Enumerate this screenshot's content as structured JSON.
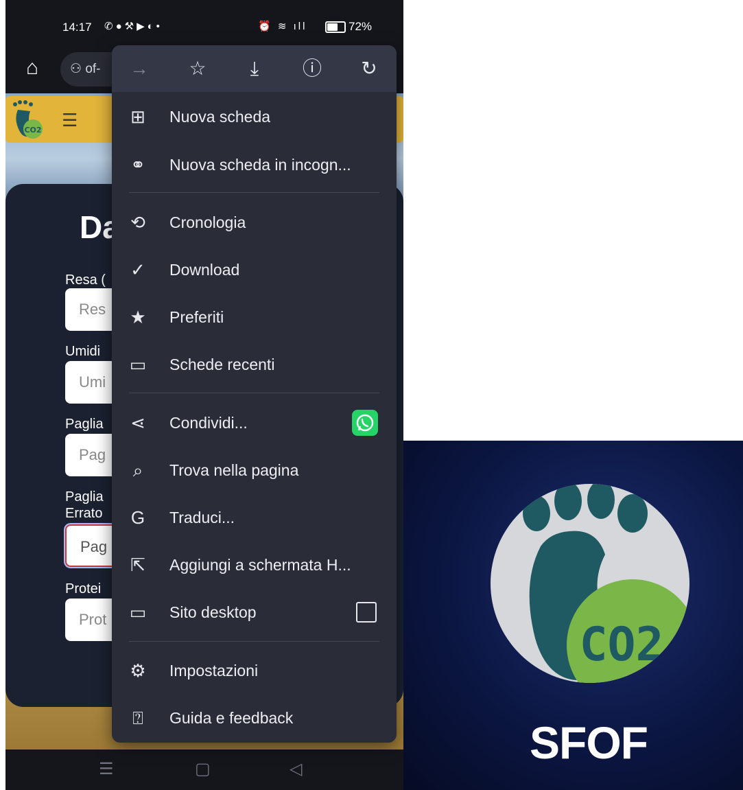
{
  "status_bar": {
    "time": "14:17",
    "notification_icons": [
      "whatsapp-icon",
      "snapchat-icon",
      "tool-icon",
      "youtube-icon",
      "messenger-icon",
      "dot-icon"
    ],
    "system_icons": [
      "alarm-icon",
      "wifi-icon",
      "signal-icon"
    ],
    "battery": "72%"
  },
  "browser": {
    "url_fragment": "of-"
  },
  "webpage": {
    "form_title": "Da",
    "fields": [
      {
        "label": "Resa (",
        "placeholder": "Res"
      },
      {
        "label": "Umidi",
        "placeholder": "Umi"
      },
      {
        "label": "Paglia",
        "placeholder": "Pag"
      },
      {
        "label": "Paglia Errato",
        "placeholder": "Pag"
      },
      {
        "label": "Protei",
        "placeholder": "Prot"
      }
    ]
  },
  "menu": {
    "toolbar": [
      "forward-icon",
      "bookmark-star-icon",
      "download-icon",
      "info-icon",
      "reload-icon"
    ],
    "items": [
      {
        "label": "Nuova scheda",
        "icon": "new-tab-icon"
      },
      {
        "label": "Nuova scheda in incogn...",
        "icon": "incognito-icon"
      },
      {
        "label": "Cronologia",
        "icon": "history-icon"
      },
      {
        "label": "Download",
        "icon": "downloads-icon"
      },
      {
        "label": "Preferiti",
        "icon": "star-icon"
      },
      {
        "label": "Schede recenti",
        "icon": "devices-icon"
      },
      {
        "label": "Condividi...",
        "icon": "share-icon"
      },
      {
        "label": "Trova nella pagina",
        "icon": "find-in-page-icon"
      },
      {
        "label": "Traduci...",
        "icon": "translate-icon"
      },
      {
        "label": "Aggiungi a schermata H...",
        "icon": "add-to-home-icon"
      },
      {
        "label": "Sito desktop",
        "icon": "desktop-icon"
      },
      {
        "label": "Impostazioni",
        "icon": "settings-icon"
      },
      {
        "label": "Guida e feedback",
        "icon": "help-icon"
      }
    ],
    "desktop_site_checked": false
  },
  "app_icon": {
    "logo_text": "CO2",
    "name": "SFOF"
  },
  "colors": {
    "menu_bg": "#2a2d37",
    "header_yellow": "#e2b43a",
    "whatsapp_green": "#25d366",
    "logo_teal": "#1f5a63",
    "logo_green": "#7ab648"
  }
}
